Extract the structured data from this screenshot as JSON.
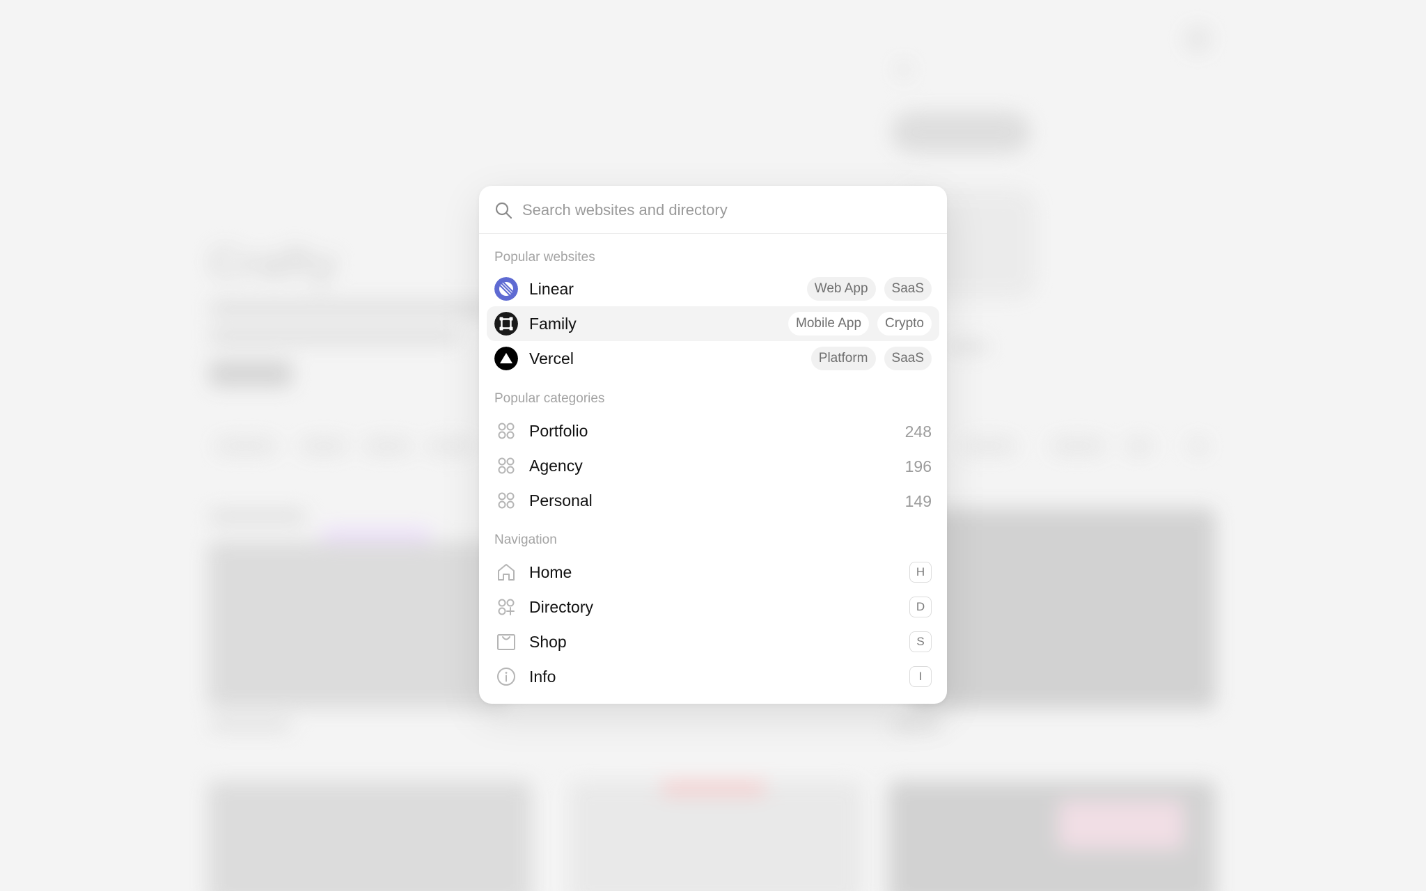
{
  "background": {
    "title": "Crafty"
  },
  "search": {
    "placeholder": "Search websites and directory"
  },
  "sections": {
    "popular_websites": "Popular websites",
    "popular_categories": "Popular categories",
    "navigation": "Navigation"
  },
  "websites": [
    {
      "name": "Linear",
      "icon": "linear-logo-icon",
      "tags": [
        "Web App",
        "SaaS"
      ],
      "selected": false
    },
    {
      "name": "Family",
      "icon": "family-logo-icon",
      "tags": [
        "Mobile App",
        "Crypto"
      ],
      "selected": true
    },
    {
      "name": "Vercel",
      "icon": "vercel-logo-icon",
      "tags": [
        "Platform",
        "SaaS"
      ],
      "selected": false
    }
  ],
  "categories": [
    {
      "name": "Portfolio",
      "icon": "grid-dots-icon",
      "count": "248"
    },
    {
      "name": "Agency",
      "icon": "grid-dots-icon",
      "count": "196"
    },
    {
      "name": "Personal",
      "icon": "grid-dots-icon",
      "count": "149"
    }
  ],
  "navigation": [
    {
      "name": "Home",
      "icon": "home-icon",
      "shortcut": "H"
    },
    {
      "name": "Directory",
      "icon": "directory-icon",
      "shortcut": "D"
    },
    {
      "name": "Shop",
      "icon": "shop-icon",
      "shortcut": "S"
    },
    {
      "name": "Info",
      "icon": "info-icon",
      "shortcut": "I"
    }
  ],
  "colors": {
    "linear_brand": "#5E6AD2",
    "selected_row_bg": "#F3F3F3",
    "muted_text": "#A3A3A3"
  }
}
